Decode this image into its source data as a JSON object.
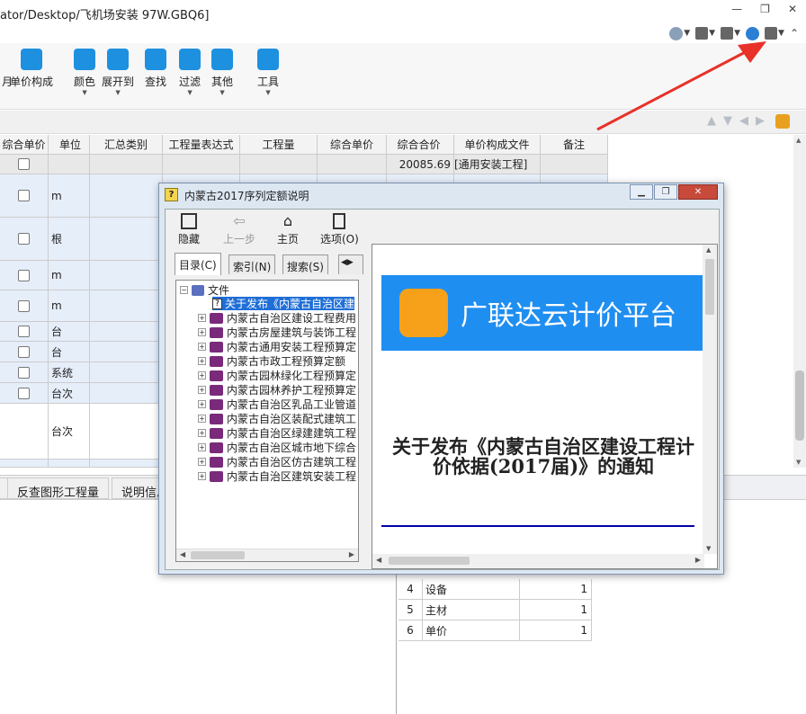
{
  "window": {
    "title": "ator/Desktop/飞机场安装 97W.GBQ6]"
  },
  "ribbon": [
    {
      "label": "月",
      "icon": "partial-icon",
      "color": "#ffffff"
    },
    {
      "label": "单价构成",
      "icon": "price-structure-icon",
      "color": "#1e90e0"
    },
    {
      "label": "颜色",
      "icon": "paint-bucket-icon",
      "color": "#1e90e0"
    },
    {
      "label": "展开到",
      "icon": "tree-expand-icon",
      "color": "#1e90e0"
    },
    {
      "label": "查找",
      "icon": "binoculars-icon",
      "color": "#1e90e0"
    },
    {
      "label": "过滤",
      "icon": "filter-icon",
      "color": "#1e90e0"
    },
    {
      "label": "其他",
      "icon": "grid-apps-icon",
      "color": "#1e90e0"
    },
    {
      "label": "工具",
      "icon": "tools-icon",
      "color": "#1e90e0"
    }
  ],
  "grid": {
    "headers": [
      "综合单价",
      "单位",
      "汇总类别",
      "工程量表达式",
      "工程量",
      "综合单价",
      "综合合价",
      "单价构成文件",
      "备注"
    ],
    "rows": [
      {
        "unit": "",
        "total": "20085.69",
        "file": "[通用安装工程]"
      },
      {
        "unit": "m",
        "total": "",
        "file": ""
      },
      {
        "unit": "根",
        "total": "",
        "file": ""
      },
      {
        "unit": "m",
        "total": "",
        "file": ""
      },
      {
        "unit": "m",
        "total": "",
        "file": ""
      },
      {
        "unit": "台",
        "total": "",
        "file": ""
      },
      {
        "unit": "台",
        "total": "",
        "file": ""
      },
      {
        "unit": "系统",
        "total": "",
        "file": ""
      },
      {
        "unit": "台次",
        "total": "",
        "file": ""
      },
      {
        "unit": "台次",
        "total": "",
        "file": ""
      }
    ]
  },
  "tabs": {
    "left_label": "",
    "reverse_label": "反查图形工程量",
    "desc_label": "说明信息"
  },
  "bottom_table": [
    {
      "no": "4",
      "name": "设备",
      "value": "1"
    },
    {
      "no": "5",
      "name": "主材",
      "value": "1"
    },
    {
      "no": "6",
      "name": "单价",
      "value": "1"
    }
  ],
  "dialog": {
    "title": "内蒙古2017序列定额说明",
    "toolbar": {
      "hide": "隐藏",
      "back": "上一步",
      "home": "主页",
      "options": "选项(O)"
    },
    "tabs": {
      "toc": "目录(C)",
      "index": "索引(N)",
      "search": "搜索(S)"
    },
    "tree": {
      "root": "文件",
      "first": "关于发布《内蒙古自治区建",
      "items": [
        "内蒙古自治区建设工程费用",
        "内蒙古房屋建筑与装饰工程",
        "内蒙古通用安装工程预算定",
        "内蒙古市政工程预算定额",
        "内蒙古园林绿化工程预算定",
        "内蒙古园林养护工程预算定",
        "内蒙古自治区乳品工业管道",
        "内蒙古自治区装配式建筑工",
        "内蒙古自治区绿建建筑工程",
        "内蒙古自治区城市地下综合",
        "内蒙古自治区仿古建筑工程",
        "内蒙古自治区建筑安装工程"
      ]
    },
    "content": {
      "banner": "广联达云计价平台",
      "heading": "关于发布《内蒙古自治区建设工程计价依据(2017届)》的通知"
    }
  },
  "colors": {
    "accent": "#1f8ef1",
    "arrow": "#e8312a",
    "logo": "#f7a11a"
  }
}
